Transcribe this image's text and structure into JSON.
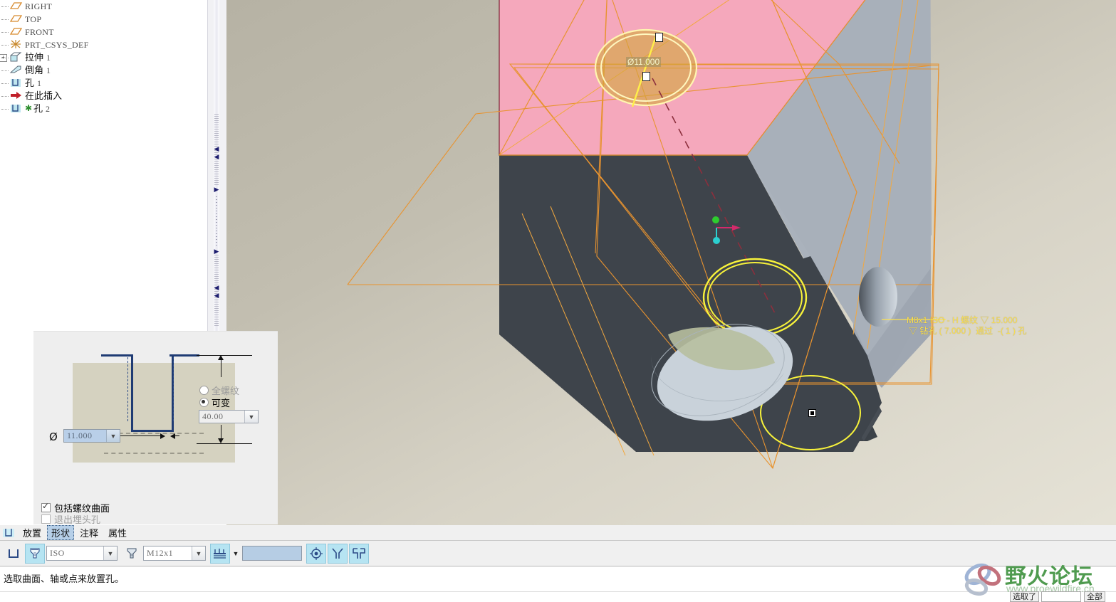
{
  "model_tree": {
    "items": [
      {
        "label": "RIGHT",
        "icon": "datum-plane-icon",
        "suffix": "",
        "cjk": false,
        "expandable": false,
        "marked": false
      },
      {
        "label": "TOP",
        "icon": "datum-plane-icon",
        "suffix": "",
        "cjk": false,
        "expandable": false,
        "marked": false
      },
      {
        "label": "FRONT",
        "icon": "datum-plane-icon",
        "suffix": "",
        "cjk": false,
        "expandable": false,
        "marked": false
      },
      {
        "label": "PRT_CSYS_DEF",
        "icon": "coordinate-system-icon",
        "suffix": "",
        "cjk": false,
        "expandable": false,
        "marked": false
      },
      {
        "label": "拉伸",
        "icon": "extrude-feature-icon",
        "suffix": "1",
        "cjk": true,
        "expandable": true,
        "marked": false
      },
      {
        "label": "倒角",
        "icon": "chamfer-feature-icon",
        "suffix": "1",
        "cjk": true,
        "expandable": false,
        "marked": false
      },
      {
        "label": "孔",
        "icon": "hole-feature-icon",
        "suffix": "1",
        "cjk": true,
        "expandable": false,
        "marked": false
      },
      {
        "label": "在此插入",
        "icon": "insert-here-arrow-icon",
        "suffix": "",
        "cjk": true,
        "expandable": false,
        "marked": false
      },
      {
        "label": "孔",
        "icon": "hole-feature-icon",
        "suffix": "2",
        "cjk": true,
        "expandable": false,
        "marked": true
      }
    ]
  },
  "viewport": {
    "diameter_callout": "Ø11.000",
    "hole_note_line1": "M8x1 ISO - H 螺纹 ▽ 15.000",
    "hole_note_line2": "▽ 钻孔 ( 7.000 )  通过  -( 1 ) 孔",
    "background_note": "3d-model-graphics-window"
  },
  "shape_panel": {
    "radio_full_thread": "全螺纹",
    "radio_variable": "可变",
    "radio_selected": "可变",
    "depth_value": "40.00",
    "diameter_value": "11.000",
    "diameter_symbol": "Ø",
    "checkbox_include_thread_surface": "包括螺纹曲面",
    "checkbox_include_thread_surface_checked": true,
    "checkbox_exit_counterbore": "退出埋头孔",
    "checkbox_exit_counterbore_checked": false
  },
  "tabs": {
    "items": [
      "放置",
      "形状",
      "注释",
      "属性"
    ],
    "active": "形状"
  },
  "options_toolbar": {
    "standard_select_label": "ISO",
    "screw_size_label": "M12x1",
    "color_swatch": "#b6cde4",
    "buttons": [
      {
        "name": "simple-hole-button",
        "selected": false
      },
      {
        "name": "standard-hole-button",
        "selected": true
      },
      {
        "name": "tapped-hole-button",
        "selected": false
      },
      {
        "name": "depth-style-button",
        "selected": false
      },
      {
        "name": "through-all-button",
        "selected": true
      },
      {
        "name": "countersink-button",
        "selected": true
      },
      {
        "name": "counterbore-button",
        "selected": true
      }
    ]
  },
  "status_bar": {
    "message": "选取曲面、轴或点来放置孔。"
  },
  "watermark": {
    "title": "野火论坛",
    "url": "www.proewildfire.cn",
    "brand_green": "#4f9b4f"
  },
  "select_widget": {
    "label": "选取了",
    "count": "",
    "all_label": "全部"
  }
}
